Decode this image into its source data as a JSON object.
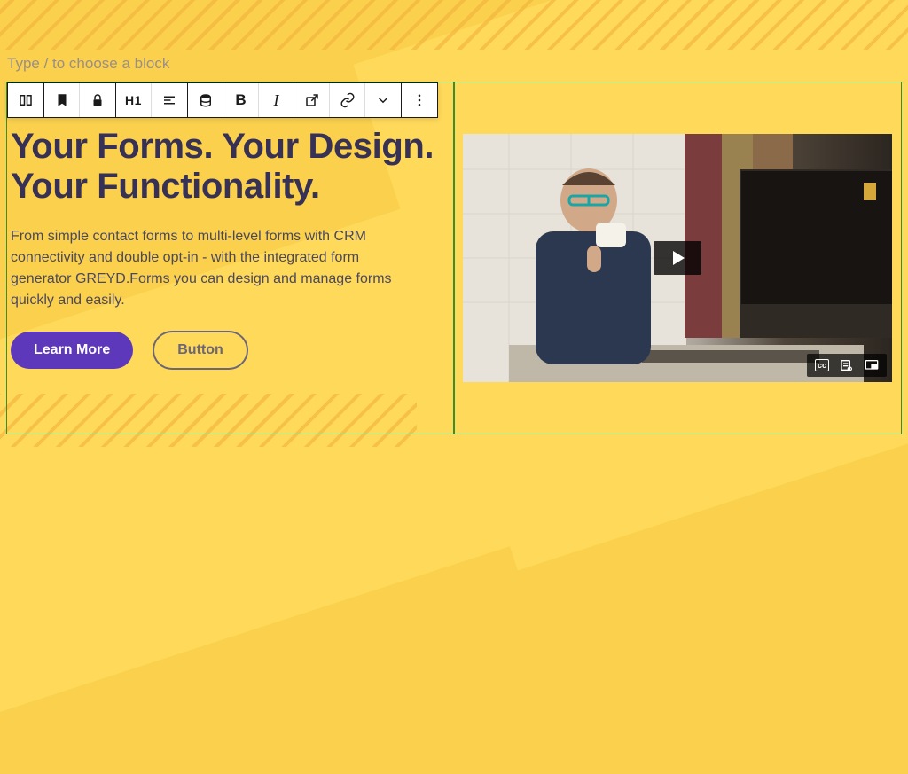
{
  "placeholder": "Type / to choose a block",
  "toolbar": {
    "heading_level": "H1"
  },
  "hero": {
    "title": "Your Forms. Your Design. Your Functionality.",
    "description": "From simple contact forms to multi-level forms with CRM connectivity and double opt-in - with the integrated form generator GREYD.Forms you can design and manage forms quickly and easily.",
    "primary_button": "Learn More",
    "secondary_button": "Button"
  },
  "video": {
    "captions_label": "cc"
  },
  "colors": {
    "accent": "#5E38BA",
    "background": "#FAD04D",
    "selection": "#3a8f2d",
    "text_dark": "#373155"
  }
}
